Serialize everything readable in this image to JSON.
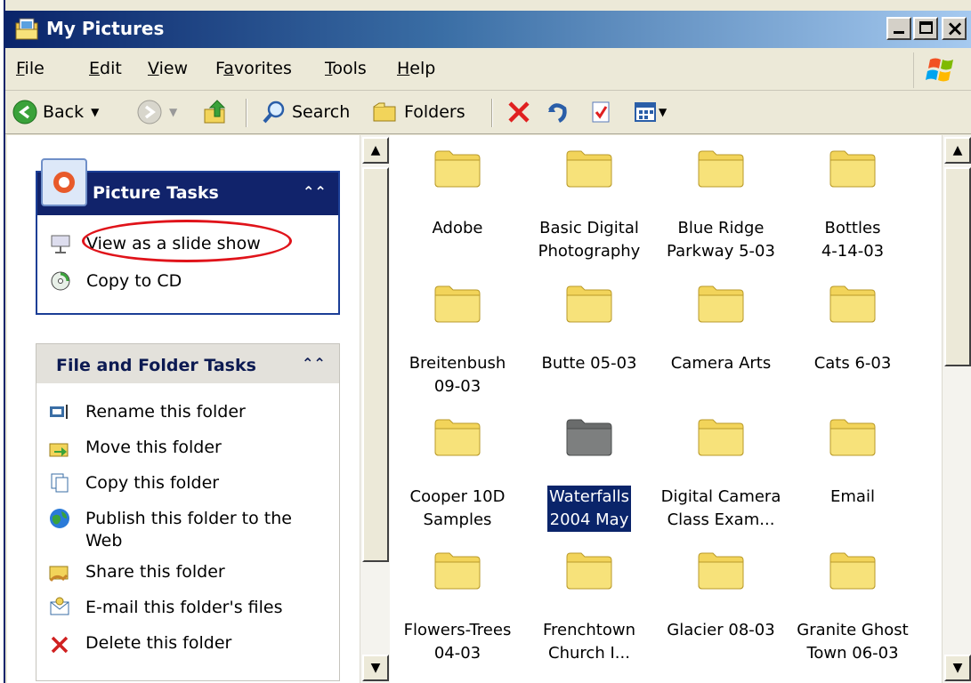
{
  "window": {
    "title": "My Pictures"
  },
  "caption_buttons": {
    "minimize": "minimize",
    "maximize": "maximize",
    "close": "close"
  },
  "menu": {
    "items": [
      {
        "label": "File",
        "key": "F",
        "rest": "ile"
      },
      {
        "label": "Edit",
        "key": "E",
        "rest": "dit"
      },
      {
        "label": "View",
        "key": "V",
        "rest": "iew"
      },
      {
        "label": "Favorites",
        "pre": "F",
        "key": "a",
        "rest": "vorites"
      },
      {
        "label": "Tools",
        "key": "T",
        "rest": "ools"
      },
      {
        "label": "Help",
        "key": "H",
        "rest": "elp"
      }
    ]
  },
  "toolbar": {
    "back": "Back",
    "search": "Search",
    "folders": "Folders"
  },
  "picture_tasks": {
    "title": "Picture Tasks",
    "items": [
      {
        "label": "View as a slide show",
        "icon": "slideshow-icon"
      },
      {
        "label": "Copy to CD",
        "icon": "cd-icon"
      }
    ]
  },
  "file_tasks": {
    "title": "File and Folder Tasks",
    "items": [
      {
        "label": "Rename this folder",
        "icon": "rename-icon"
      },
      {
        "label": "Move this folder",
        "icon": "move-icon"
      },
      {
        "label": "Copy this folder",
        "icon": "copy-icon"
      },
      {
        "label_line1": "Publish this folder to the",
        "label_line2": "Web",
        "icon": "publish-web-icon"
      },
      {
        "label": "Share this folder",
        "icon": "share-icon"
      },
      {
        "label": "E-mail this folder's files",
        "icon": "email-icon"
      },
      {
        "label": "Delete this folder",
        "icon": "delete-icon"
      }
    ]
  },
  "folders": [
    {
      "line1": "Adobe",
      "line2": ""
    },
    {
      "line1": "Basic Digital",
      "line2": "Photography"
    },
    {
      "line1": "Blue Ridge",
      "line2": "Parkway 5-03"
    },
    {
      "line1": "Bottles",
      "line2": "4-14-03"
    },
    {
      "line1": "Breitenbush",
      "line2": "09-03"
    },
    {
      "line1": "Butte 05-03",
      "line2": ""
    },
    {
      "line1": "Camera Arts",
      "line2": ""
    },
    {
      "line1": "Cats 6-03",
      "line2": ""
    },
    {
      "line1": "Cooper 10D",
      "line2": "Samples"
    },
    {
      "line1": "Waterfalls",
      "line2": "2004 May",
      "selected": true
    },
    {
      "line1": "Digital Camera",
      "line2": "Class Exam..."
    },
    {
      "line1": "Email",
      "line2": ""
    },
    {
      "line1": "Flowers-Trees",
      "line2": "04-03"
    },
    {
      "line1": "Frenchtown",
      "line2": "Church I..."
    },
    {
      "line1": "Glacier 08-03",
      "line2": ""
    },
    {
      "line1": "Granite Ghost",
      "line2": "Town 06-03"
    }
  ],
  "colors": {
    "title_bar": "#0a246a",
    "selection": "#0a246a",
    "annotation": "#e0131a",
    "folder_yellow": "#f7e27a"
  }
}
